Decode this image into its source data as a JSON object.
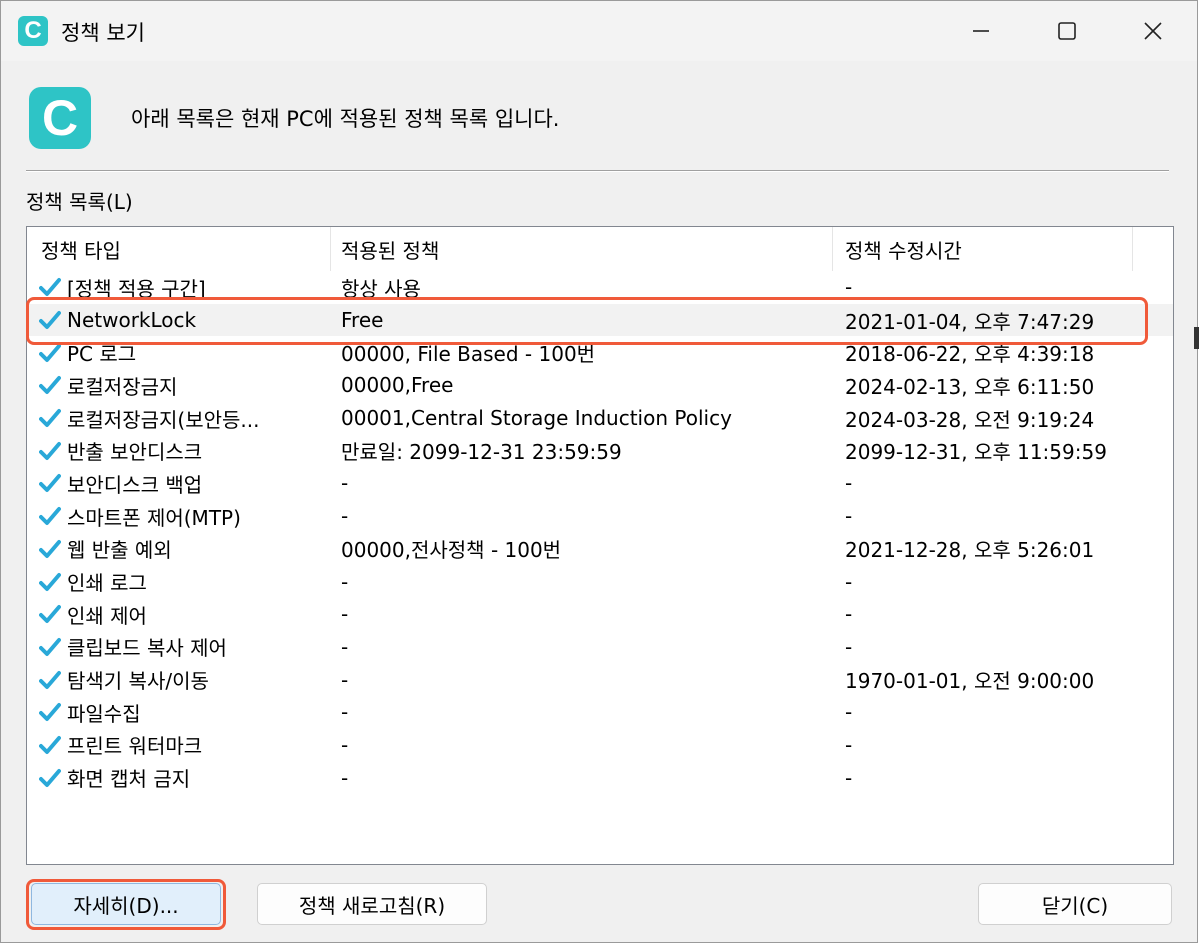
{
  "window": {
    "title": "정책 보기",
    "app_icon_letter": "C"
  },
  "header": {
    "message": "아래 목록은 현재 PC에 적용된 정책 목록 입니다."
  },
  "list": {
    "group_label": "정책 목록(L)",
    "columns": [
      "정책 타입",
      "적용된 정책",
      "정책 수정시간"
    ],
    "rows": [
      {
        "type": "[정책 적용 구간]",
        "policy": "항상 사용",
        "modified": "-",
        "selected": false
      },
      {
        "type": "NetworkLock",
        "policy": "Free",
        "modified": "2021-01-04, 오후 7:47:29",
        "selected": true
      },
      {
        "type": "PC 로그",
        "policy": "00000, File Based - 100번",
        "modified": "2018-06-22, 오후 4:39:18",
        "selected": false
      },
      {
        "type": "로컬저장금지",
        "policy": "00000,Free",
        "modified": "2024-02-13, 오후 6:11:50",
        "selected": false
      },
      {
        "type": "로컬저장금지(보안등...",
        "policy": "00001,Central Storage Induction Policy",
        "modified": "2024-03-28, 오전 9:19:24",
        "selected": false
      },
      {
        "type": "반출 보안디스크",
        "policy": "만료일: 2099-12-31 23:59:59",
        "modified": "2099-12-31, 오후 11:59:59",
        "selected": false
      },
      {
        "type": "보안디스크 백업",
        "policy": "-",
        "modified": "-",
        "selected": false
      },
      {
        "type": "스마트폰 제어(MTP)",
        "policy": "-",
        "modified": "-",
        "selected": false
      },
      {
        "type": "웹 반출 예외",
        "policy": "00000,전사정책 - 100번",
        "modified": "2021-12-28, 오후 5:26:01",
        "selected": false
      },
      {
        "type": "인쇄 로그",
        "policy": "-",
        "modified": "-",
        "selected": false
      },
      {
        "type": "인쇄 제어",
        "policy": "-",
        "modified": "-",
        "selected": false
      },
      {
        "type": "클립보드 복사 제어",
        "policy": "-",
        "modified": "-",
        "selected": false
      },
      {
        "type": "탐색기 복사/이동",
        "policy": "-",
        "modified": "1970-01-01, 오전 9:00:00",
        "selected": false
      },
      {
        "type": "파일수집",
        "policy": "-",
        "modified": "-",
        "selected": false
      },
      {
        "type": "프린트 워터마크",
        "policy": "-",
        "modified": "-",
        "selected": false
      },
      {
        "type": "화면 캡처 금지",
        "policy": "-",
        "modified": "-",
        "selected": false
      }
    ]
  },
  "buttons": {
    "details": "자세히(D)...",
    "refresh": "정책 새로고침(R)",
    "close": "닫기(C)"
  },
  "colors": {
    "accent": "#2ec4c6",
    "check": "#29a8d8",
    "highlight": "#f05a3a"
  }
}
